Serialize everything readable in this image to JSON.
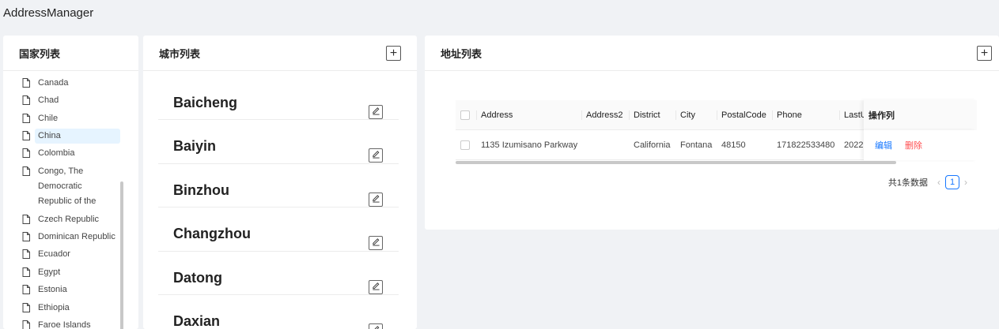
{
  "app": {
    "title": "AddressManager"
  },
  "country_panel": {
    "title": "国家列表",
    "items": [
      {
        "label": "Canada"
      },
      {
        "label": "Chad"
      },
      {
        "label": "Chile"
      },
      {
        "label": "China",
        "selected": true
      },
      {
        "label": "Colombia"
      },
      {
        "label": "Congo, The Democratic Republic of the"
      },
      {
        "label": "Czech Republic"
      },
      {
        "label": "Dominican Republic"
      },
      {
        "label": "Ecuador"
      },
      {
        "label": "Egypt"
      },
      {
        "label": "Estonia"
      },
      {
        "label": "Ethiopia"
      },
      {
        "label": "Faroe Islands"
      }
    ]
  },
  "city_panel": {
    "title": "城市列表",
    "add_label": "+",
    "cities": [
      "Baicheng",
      "Baiyin",
      "Binzhou",
      "Changzhou",
      "Datong",
      "Daxian"
    ]
  },
  "address_panel": {
    "title": "地址列表",
    "add_label": "+",
    "columns": [
      "Address",
      "Address2",
      "District",
      "City",
      "PostalCode",
      "Phone",
      "LastU",
      "操作列"
    ],
    "rows": [
      {
        "address": "1135 Izumisano Parkway",
        "address2": "",
        "district": "California",
        "city": "Fontana",
        "postal_code": "48150",
        "phone": "171822533480",
        "last_update": "2022",
        "edit_label": "编辑",
        "delete_label": "删除"
      }
    ],
    "pagination": {
      "total_text": "共1条数据",
      "current_page": "1",
      "prev": "‹",
      "next": "›"
    }
  },
  "colors": {
    "accent": "#1677ff",
    "danger": "#ff4d4f",
    "selected_bg": "#e6f4ff"
  }
}
